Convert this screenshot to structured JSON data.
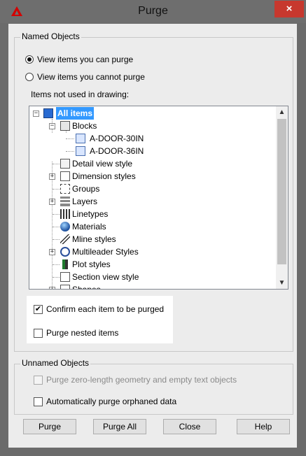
{
  "window": {
    "title": "Purge",
    "close_label": "×"
  },
  "named_objects": {
    "legend": "Named Objects",
    "radio_view_can": "View items you can purge",
    "radio_view_cannot": "View items you cannot purge",
    "items_label": "Items not used in drawing:",
    "tree": {
      "all_items": "All items",
      "blocks": "Blocks",
      "block_children": [
        "A-DOOR-30IN",
        "A-DOOR-36IN"
      ],
      "items": [
        "Detail view style",
        "Dimension styles",
        "Groups",
        "Layers",
        "Linetypes",
        "Materials",
        "Mline styles",
        "Multileader Styles",
        "Plot styles",
        "Section view style",
        "Shapes"
      ]
    },
    "confirm_label": "Confirm each item to be purged",
    "confirm_checked": true,
    "nested_label": "Purge nested items",
    "nested_checked": false
  },
  "unnamed_objects": {
    "legend": "Unnamed Objects",
    "zero_length_label": "Purge zero-length geometry and empty text objects",
    "orphaned_label": "Automatically purge orphaned data"
  },
  "buttons": {
    "purge": "Purge",
    "purge_all": "Purge All",
    "close": "Close",
    "help": "Help"
  }
}
